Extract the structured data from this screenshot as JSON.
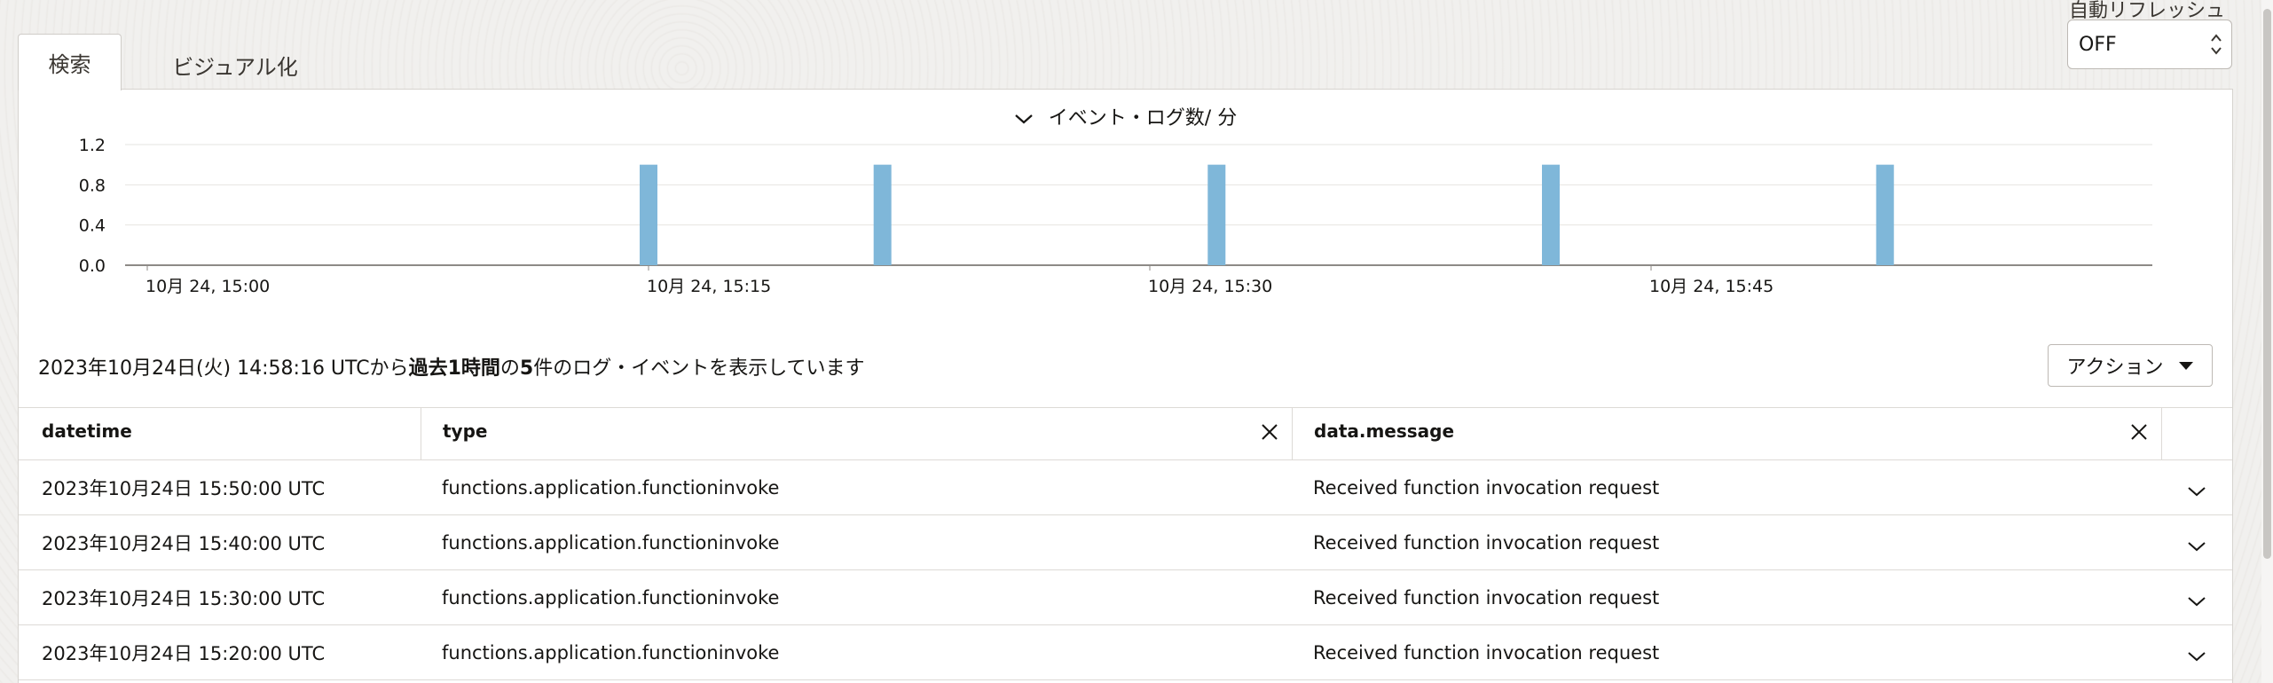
{
  "tabs": [
    {
      "label": "検索",
      "active": true
    },
    {
      "label": "ビジュアル化",
      "active": false
    }
  ],
  "auto_refresh": {
    "label": "自動リフレッシュ",
    "value": "OFF"
  },
  "chart_data": {
    "type": "bar",
    "title": "イベント・ログ数/ 分",
    "x_ticks": [
      "10月 24, 15:00",
      "10月 24, 15:15",
      "10月 24, 15:30",
      "10月 24, 15:45"
    ],
    "y_ticks": [
      "1.2",
      "0.8",
      "0.4",
      "0.0"
    ],
    "ylim": [
      0,
      1.2
    ],
    "x_range_minutes": [
      0,
      60
    ],
    "bars": [
      {
        "minute": 15,
        "value": 1
      },
      {
        "minute": 22,
        "value": 1
      },
      {
        "minute": 32,
        "value": 1
      },
      {
        "minute": 42,
        "value": 1
      },
      {
        "minute": 52,
        "value": 1
      }
    ],
    "bar_color": "#7fb7d9",
    "grid": true
  },
  "summary": {
    "prefix": "2023年10月24日(火) 14:58:16 UTCから",
    "period": "過去1時間",
    "middle": "の",
    "count": "5",
    "suffix": "件のログ・イベントを表示しています"
  },
  "action_button": {
    "label": "アクション"
  },
  "table": {
    "columns": [
      "datetime",
      "type",
      "data.message"
    ],
    "rows": [
      {
        "datetime": "2023年10月24日 15:50:00 UTC",
        "type": "functions.application.functioninvoke",
        "message": "Received function invocation request"
      },
      {
        "datetime": "2023年10月24日 15:40:00 UTC",
        "type": "functions.application.functioninvoke",
        "message": "Received function invocation request"
      },
      {
        "datetime": "2023年10月24日 15:30:00 UTC",
        "type": "functions.application.functioninvoke",
        "message": "Received function invocation request"
      },
      {
        "datetime": "2023年10月24日 15:20:00 UTC",
        "type": "functions.application.functioninvoke",
        "message": "Received function invocation request"
      }
    ]
  }
}
